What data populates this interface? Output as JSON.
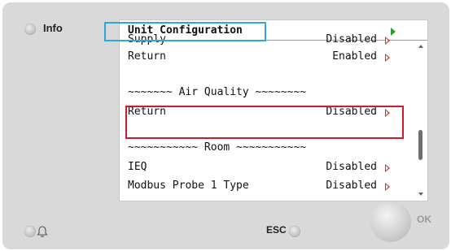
{
  "panel": {
    "info_label": "Info",
    "esc_label": "ESC",
    "ok_label": "OK"
  },
  "screen": {
    "title": "Unit Configuration",
    "rows": [
      {
        "name": "Supply",
        "value": "Disabled"
      },
      {
        "name": "Return",
        "value": "Enabled"
      },
      {
        "name": "",
        "value": ""
      },
      {
        "name": "~~~~~~~ Air Quality ~~~~~~~~",
        "value": ""
      },
      {
        "name": "Return",
        "value": "Disabled"
      },
      {
        "name": "",
        "value": ""
      },
      {
        "name": "~~~~~~~~~~~ Room ~~~~~~~~~~~",
        "value": ""
      },
      {
        "name": "IEQ",
        "value": "Disabled"
      },
      {
        "name": "Modbus Probe 1 Type",
        "value": "Disabled"
      }
    ]
  },
  "icons": {
    "title_arrow": "green-right-triangle",
    "row_arrow": "red-right-triangle",
    "bell": "bell-icon"
  },
  "colors": {
    "title_highlight": "#2aa8df",
    "selection_highlight": "#d0192b",
    "title_arrow": "#2c9a2c",
    "row_arrow": "#e02a2a"
  }
}
